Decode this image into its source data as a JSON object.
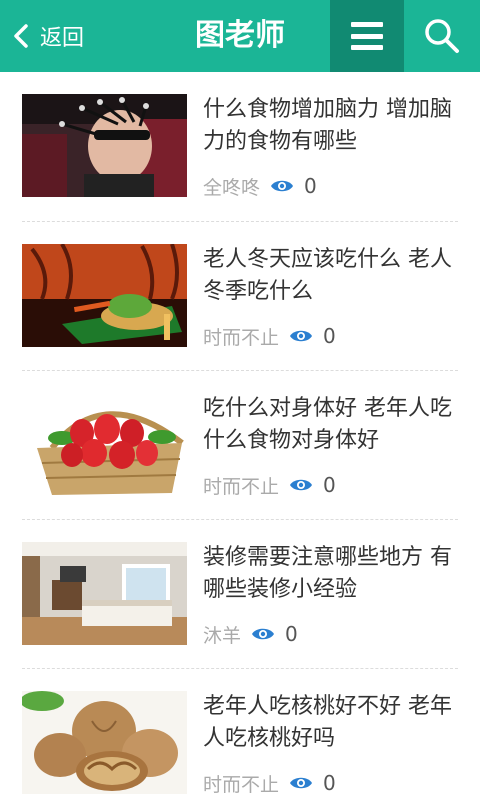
{
  "header": {
    "back_label": "返回",
    "title": "图老师",
    "accent": "#1bb596",
    "accent_dark": "#118a72",
    "icons": [
      "chevron-left-icon",
      "menu-icon",
      "search-icon"
    ]
  },
  "articles": [
    {
      "title": "什么食物增加脑力 增加脑力的食物有哪些",
      "author": "全咚咚",
      "views": "0",
      "thumb": "man-with-brain-sensors"
    },
    {
      "title": "老人冬天应该吃什么 老人冬季吃什么",
      "author": "时而不止",
      "views": "0",
      "thumb": "vegetable-dish"
    },
    {
      "title": "吃什么对身体好 老年人吃什么食物对身体好",
      "author": "时而不止",
      "views": "0",
      "thumb": "strawberry-basket"
    },
    {
      "title": "装修需要注意哪些地方 有哪些装修小经验",
      "author": "沐羊",
      "views": "0",
      "thumb": "bedroom-interior"
    },
    {
      "title": "老年人吃核桃好不好 老年人吃核桃好吗",
      "author": "时而不止",
      "views": "0",
      "thumb": "walnuts"
    }
  ]
}
